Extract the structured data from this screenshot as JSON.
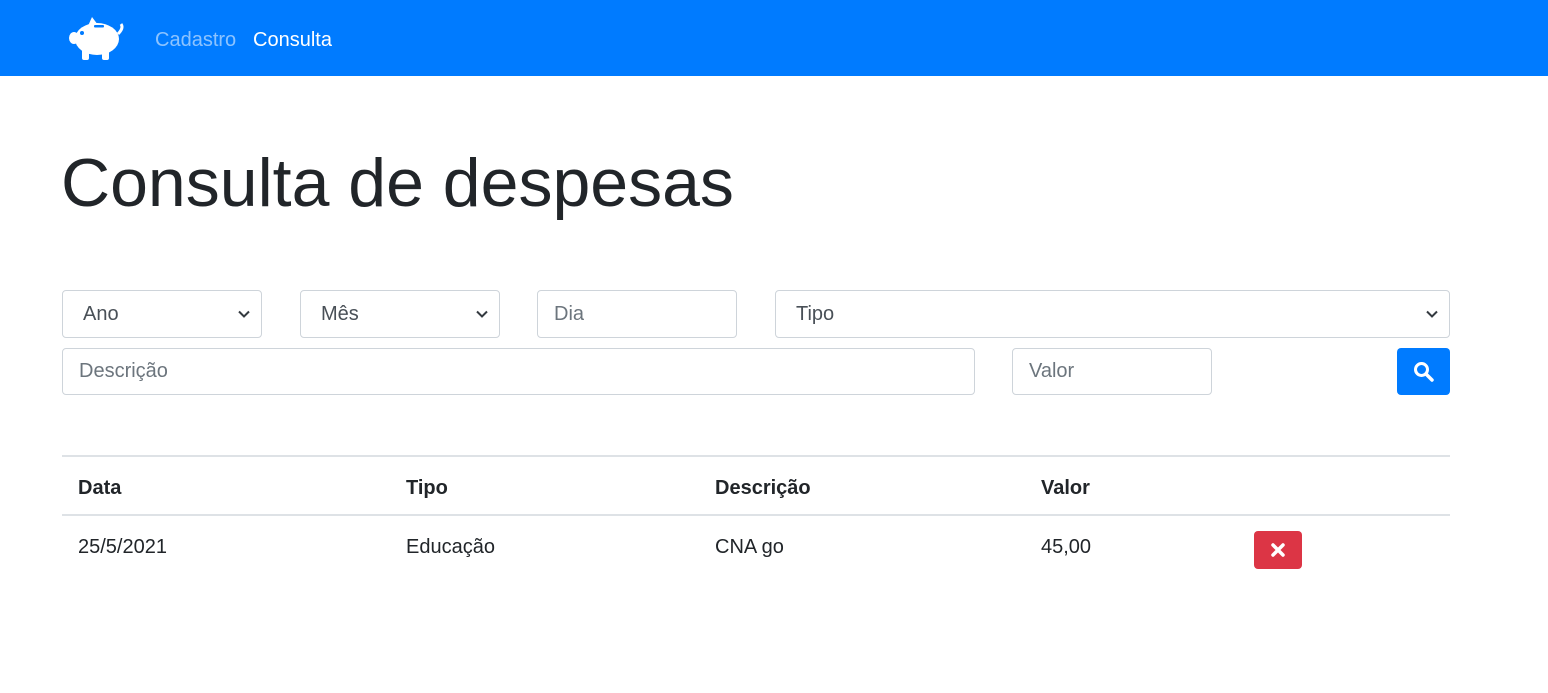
{
  "navbar": {
    "brand_icon": "piggy-bank-icon",
    "links": [
      "Cadastro",
      "Consulta"
    ],
    "active": "Consulta",
    "color": "#007bff"
  },
  "page_title": "Consulta de despesas",
  "filters": {
    "ano": "Ano",
    "mes": "Mês",
    "dia_placeholder": "Dia",
    "tipo": "Tipo",
    "descricao_placeholder": "Descrição",
    "valor_placeholder": "Valor",
    "search_icon": "search-icon"
  },
  "table": {
    "headers": [
      "Data",
      "Tipo",
      "Descrição",
      "Valor"
    ],
    "rows": [
      {
        "data": "25/5/2021",
        "tipo": "Educação",
        "descricao": "CNA go",
        "valor": "45,00"
      }
    ],
    "delete_icon": "close-icon",
    "delete_color": "#dc3545"
  }
}
